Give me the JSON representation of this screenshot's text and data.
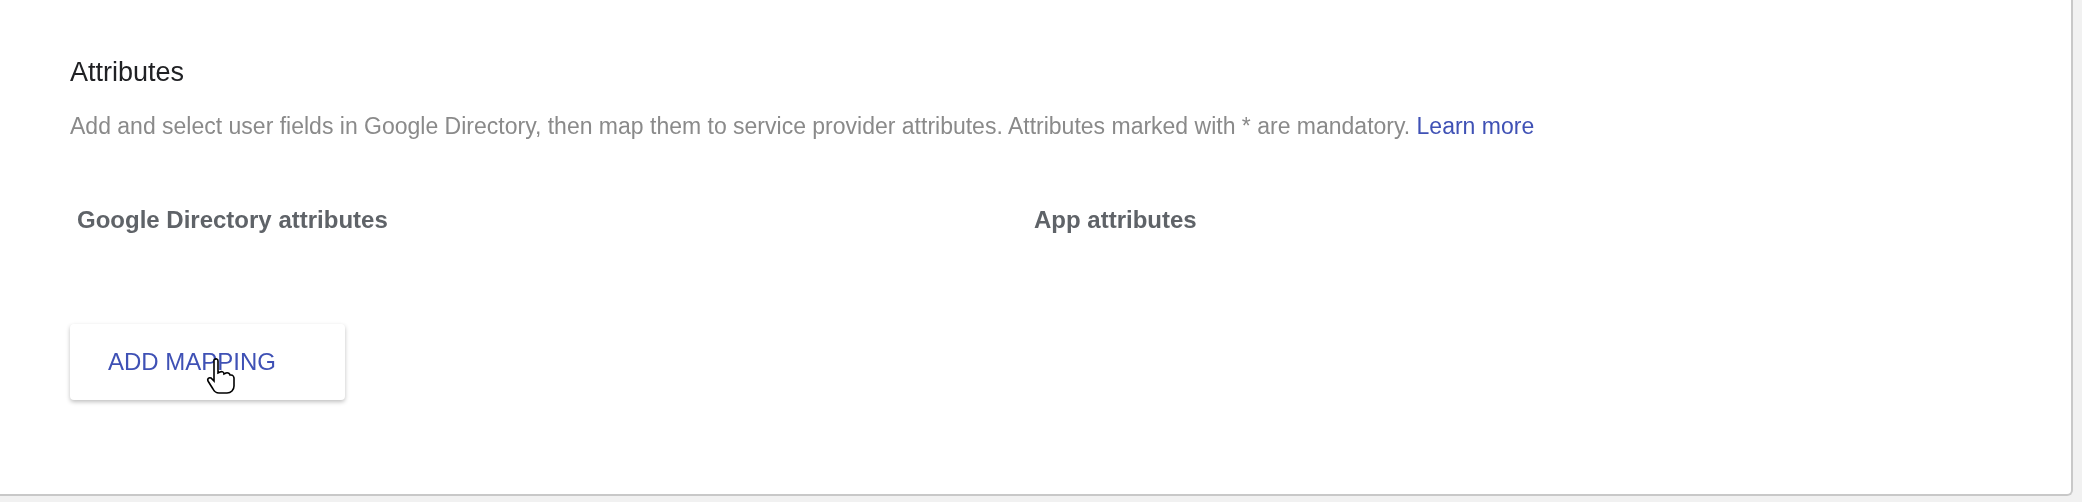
{
  "section": {
    "title": "Attributes",
    "description": "Add and select user fields in Google Directory, then map them to service provider attributes. Attributes marked with * are mandatory.",
    "link": "Learn more",
    "columns": [
      "Google Directory attributes",
      "App attributes"
    ],
    "button": "ADD MAPPING"
  }
}
